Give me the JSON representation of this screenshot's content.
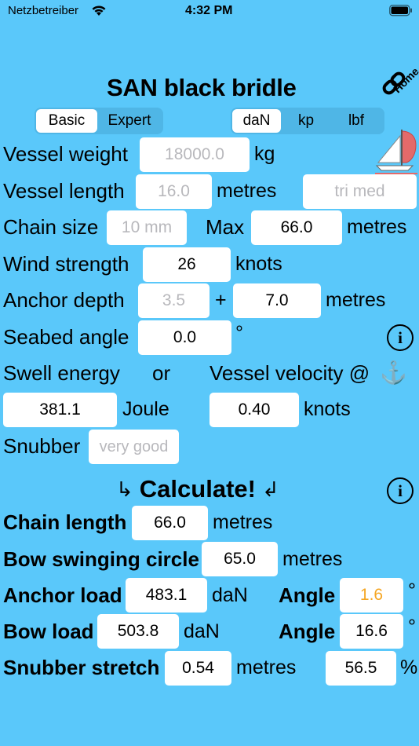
{
  "status_bar": {
    "carrier": "Netzbetreiber",
    "time": "4:32 PM"
  },
  "header": {
    "title": "SAN black bridle",
    "home_label": "Home"
  },
  "mode_tabs": [
    {
      "label": "Basic",
      "active": true
    },
    {
      "label": "Expert",
      "active": false
    }
  ],
  "unit_tabs": [
    {
      "label": "daN",
      "active": true
    },
    {
      "label": "kp",
      "active": false
    },
    {
      "label": "lbf",
      "active": false
    }
  ],
  "inputs": {
    "vessel_weight": {
      "label": "Vessel weight",
      "placeholder": "18000.0",
      "unit": "kg"
    },
    "vessel_length": {
      "label": "Vessel length",
      "placeholder": "16.0",
      "unit": "metres",
      "type_placeholder": "tri med"
    },
    "chain_size": {
      "label": "Chain size",
      "placeholder": "10 mm",
      "max_label": "Max",
      "max_value": "66.0",
      "unit": "metres"
    },
    "wind_strength": {
      "label": "Wind strength",
      "value": "26",
      "unit": "knots"
    },
    "anchor_depth": {
      "label": "Anchor depth",
      "placeholder": "3.5",
      "plus": "+",
      "value": "7.0",
      "unit": "metres"
    },
    "seabed_angle": {
      "label": "Seabed angle",
      "value": "0.0",
      "unit": "°"
    },
    "swell": {
      "label": "Swell energy",
      "or": "or",
      "velocity_label": "Vessel velocity @",
      "anchor_glyph": "⚓",
      "energy_value": "381.1",
      "energy_unit": "Joule",
      "velocity_value": "0.40",
      "velocity_unit": "knots"
    },
    "snubber": {
      "label": "Snubber",
      "placeholder": "very good"
    }
  },
  "calculate": {
    "left_arrow": "↳",
    "label": "Calculate!",
    "right_arrow": "↲"
  },
  "results": {
    "chain_length": {
      "label": "Chain length",
      "value": "66.0",
      "unit": "metres"
    },
    "bow_circle": {
      "label": "Bow swinging circle",
      "value": "65.0",
      "unit": "metres"
    },
    "anchor_load": {
      "label": "Anchor load",
      "value": "483.1",
      "unit": "daN",
      "angle_label": "Angle",
      "angle_value": "1.6",
      "angle_unit": "°"
    },
    "bow_load": {
      "label": "Bow load",
      "value": "503.8",
      "unit": "daN",
      "angle_label": "Angle",
      "angle_value": "16.6",
      "angle_unit": "°"
    },
    "snubber_stretch": {
      "label": "Snubber stretch",
      "value": "0.54",
      "unit": "metres",
      "pct_value": "56.5",
      "pct_unit": "%"
    }
  },
  "icons": {
    "info": "i",
    "accent_orange": "#f5a623",
    "background": "#5ac8fa"
  }
}
